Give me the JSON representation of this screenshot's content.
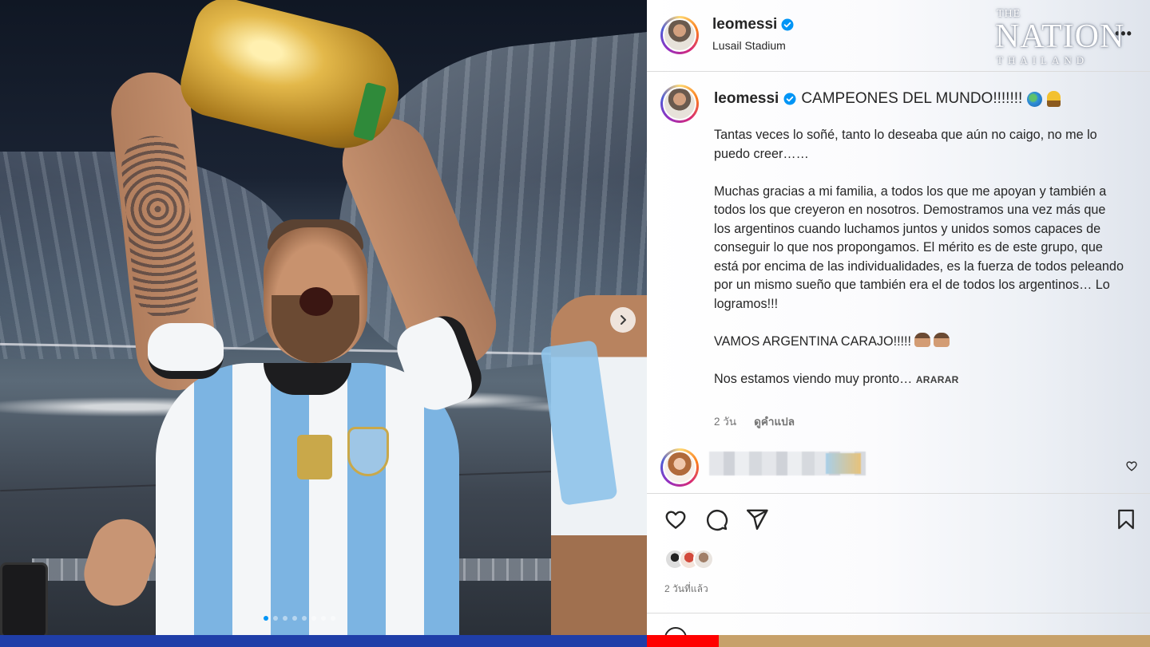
{
  "post": {
    "username": "leomessi",
    "location": "Lusail Stadium",
    "caption_title": "CAMPEONES DEL MUNDO!!!!!!!",
    "caption_paragraphs": [
      "Tantas veces lo soñé, tanto lo deseaba que aún no caigo, no me lo puedo creer……",
      "Muchas gracias a mi familia, a todos los que me apoyan y también a todos los que creyeron en nosotros. Demostramos una vez más que los argentinos cuando luchamos juntos y unidos somos capaces de conseguir lo que nos propongamos. El mérito es de este grupo, que está por encima de las individualidades, es la fuerza de todos peleando por un mismo sueño que también era el de todos los argentinos… Lo logramos!!!",
      "VAMOS ARGENTINA CARAJO!!!!!",
      "Nos estamos viendo muy pronto…"
    ],
    "caption_tag": "ARARAR",
    "caption_age": "2 วัน",
    "translate_label": "ดูคำแปล",
    "posted_ago": "2 วันที่แล้ว"
  },
  "watermark": {
    "the": "THE",
    "nation": "NATION",
    "thailand": "THAILAND"
  },
  "icons": {
    "verified": "verified-badge-icon",
    "more": "more-options-icon",
    "like": "heart-icon",
    "comment": "comment-icon",
    "share": "share-icon",
    "save": "bookmark-icon",
    "next": "chevron-right-icon"
  },
  "carousel": {
    "total_slides": 8,
    "active_index": 0
  },
  "colors": {
    "verified_blue": "#0095f6",
    "bar_blue": "#1f3ea8",
    "bar_red": "#ff0000",
    "bar_tan": "#c7a16a"
  }
}
